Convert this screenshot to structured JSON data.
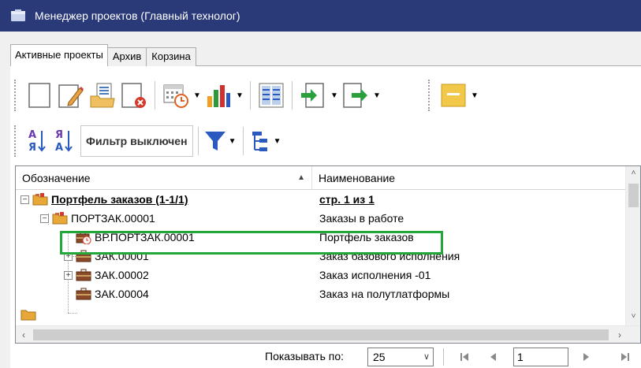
{
  "window": {
    "title": "Менеджер проектов (Главный технолог)"
  },
  "tabs": [
    {
      "label": "Активные проекты",
      "active": true
    },
    {
      "label": "Архив",
      "active": false
    },
    {
      "label": "Корзина",
      "active": false
    }
  ],
  "toolbar": {
    "filter_label": "Фильтр выключен"
  },
  "grid": {
    "columns": [
      "Обозначение",
      "Наименование"
    ],
    "rows": [
      {
        "designation": "Портфель заказов (1-1/1)",
        "name": "стр. 1 из 1",
        "level": 0,
        "expander": "−",
        "bold": true,
        "icon": "portfolio-folder-icon"
      },
      {
        "designation": "ПОРТЗАК.00001",
        "name": "Заказы в работе",
        "level": 1,
        "expander": "−",
        "bold": false,
        "icon": "portfolio-folder-icon"
      },
      {
        "designation": "ВР.ПОРТЗАК.00001",
        "name": "Портфель заказов",
        "level": 2,
        "expander": "",
        "bold": false,
        "icon": "briefcase-clock-icon"
      },
      {
        "designation": "ЗАК.00001",
        "name": "Заказ базового исполнения",
        "level": 2,
        "expander": "+",
        "bold": false,
        "icon": "briefcase-icon"
      },
      {
        "designation": "ЗАК.00002",
        "name": "Заказ исполнения -01",
        "level": 2,
        "expander": "+",
        "bold": false,
        "icon": "briefcase-icon"
      },
      {
        "designation": "ЗАК.00004",
        "name": "Заказ на полутлатформы",
        "level": 2,
        "expander": "",
        "bold": false,
        "icon": "briefcase-icon"
      }
    ]
  },
  "pager": {
    "label": "Показывать по:",
    "page_size": "25",
    "page_number": "1"
  },
  "colors": {
    "titlebar": "#2a3a78",
    "highlight": "#22a83a"
  }
}
